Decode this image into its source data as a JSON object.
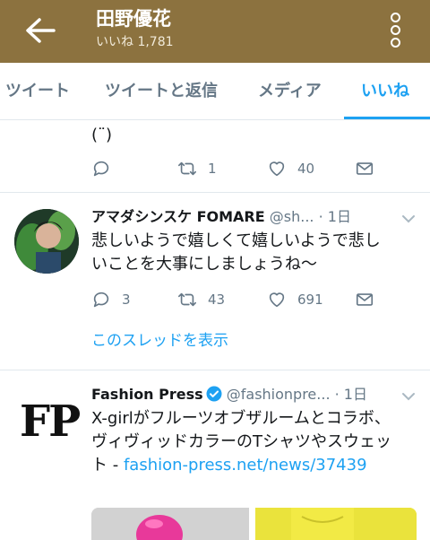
{
  "header": {
    "title": "田野優花",
    "subtitle": "いいね 1,781"
  },
  "tabs": [
    {
      "label": "ツイート"
    },
    {
      "label": "ツイートと返信"
    },
    {
      "label": "メディア"
    },
    {
      "label": "いいね"
    }
  ],
  "tweet1": {
    "text": "(¨)",
    "retweets": "1",
    "likes": "40"
  },
  "tweet2": {
    "name": "アマダシンスケ FOMARE",
    "handle": "@sh...",
    "time": "· 1日",
    "text": "悲しいようで嬉しくて嬉しいようで悲しいことを大事にしましょうね〜",
    "replies": "3",
    "retweets": "43",
    "likes": "691",
    "thread_link": "このスレッドを表示"
  },
  "tweet3": {
    "avatar_text": "FP",
    "name": "Fashion Press",
    "handle": "@fashionpre...",
    "time": "· 1日",
    "text": "X-girlがフルーツオブザルームとコラボ、ヴィヴィッドカラーのTシャツやスウェット - ",
    "link": "fashion-press.net/news/37439"
  },
  "colors": {
    "header_bg": "#8c723f",
    "accent": "#1da1f2",
    "muted": "#657786"
  }
}
